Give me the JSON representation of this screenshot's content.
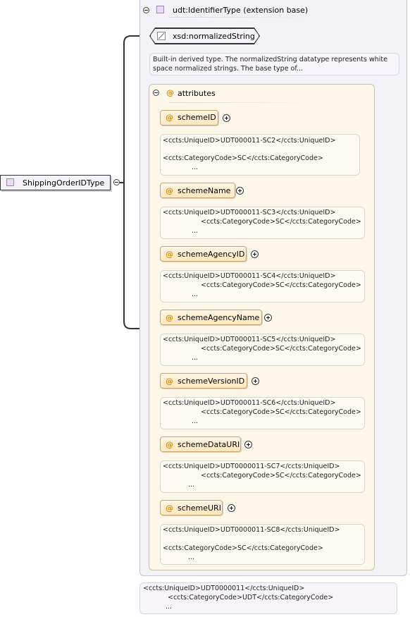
{
  "root_element": {
    "label": "ShippingOrderIDType"
  },
  "extension": {
    "label": "udt:IdentifierType (extension base)"
  },
  "base_type": {
    "label": "xsd:normalizedString",
    "doc_line1": "Built-in derived type. The normalizedString datatype represents white",
    "doc_line2": "space normalized strings. The base type of..."
  },
  "attributes_group": {
    "label": "attributes"
  },
  "attributes": [
    {
      "name": "schemeID",
      "doc1": "<ccts:UniqueID>UDT000011-SC2</ccts:UniqueID>",
      "doc2": "<ccts:CategoryCode>SC</ccts:CategoryCode>",
      "doc3": "..."
    },
    {
      "name": "schemeName",
      "doc1": "<ccts:UniqueID>UDT000011-SC3</ccts:UniqueID>",
      "doc2": "<ccts:CategoryCode>SC</ccts:CategoryCode>",
      "doc3": "..."
    },
    {
      "name": "schemeAgencyID",
      "doc1": "<ccts:UniqueID>UDT000011-SC4</ccts:UniqueID>",
      "doc2": "<ccts:CategoryCode>SC</ccts:CategoryCode>",
      "doc3": "..."
    },
    {
      "name": "schemeAgencyName",
      "doc1": "<ccts:UniqueID>UDT000011-SC5</ccts:UniqueID>",
      "doc2": "<ccts:CategoryCode>SC</ccts:CategoryCode>",
      "doc3": "..."
    },
    {
      "name": "schemeVersionID",
      "doc1": "<ccts:UniqueID>UDT000011-SC6</ccts:UniqueID>",
      "doc2": "<ccts:CategoryCode>SC</ccts:CategoryCode>",
      "doc3": "..."
    },
    {
      "name": "schemeDataURI",
      "doc1": "<ccts:UniqueID>UDT0000011-SC7</ccts:UniqueID>",
      "doc2": "<ccts:CategoryCode>SC</ccts:CategoryCode>",
      "doc3": "..."
    },
    {
      "name": "schemeURI",
      "doc1": "<ccts:UniqueID>UDT0000011-SC8</ccts:UniqueID>",
      "doc2": "<ccts:CategoryCode>SC</ccts:CategoryCode>",
      "doc3": "..."
    }
  ],
  "bottom_doc": {
    "line1": "<ccts:UniqueID>UDT0000011</ccts:UniqueID>",
    "line2": "<ccts:CategoryCode>UDT</ccts:CategoryCode>",
    "line3": "..."
  },
  "colors": {
    "attribute_at": "#e08a00",
    "attribute_fill": "#ffe7be",
    "type_square": "#eadcf2",
    "panel_bg": "#f3f2f7",
    "attr_panel_bg": "#fdf7ea"
  }
}
